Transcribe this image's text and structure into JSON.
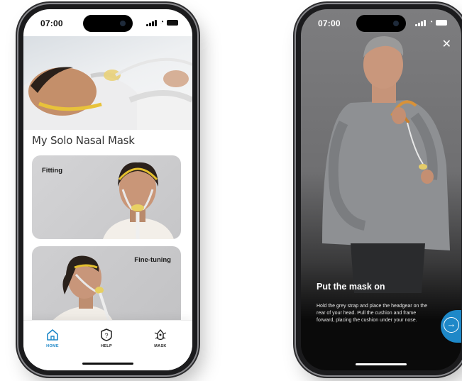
{
  "left_screen": {
    "status_time": "07:00",
    "title": "My Solo Nasal Mask",
    "cards": [
      {
        "label": "Fitting"
      },
      {
        "label": "Fine-tuning"
      }
    ],
    "tabs": [
      {
        "label": "HOME",
        "icon": "home-icon",
        "active": true
      },
      {
        "label": "HELP",
        "icon": "help-icon",
        "active": false
      },
      {
        "label": "MASK",
        "icon": "mask-icon",
        "active": false
      }
    ],
    "accent": "#1e88c8"
  },
  "right_screen": {
    "status_time": "07:00",
    "close_icon": "✕",
    "step_title": "Put the mask on",
    "step_text": "Hold the grey strap and place the headgear on the rear of your head. Pull the cushion and frame forward, placing the cushion under your nose.",
    "next_icon": "→",
    "accent": "#1e88c8"
  }
}
